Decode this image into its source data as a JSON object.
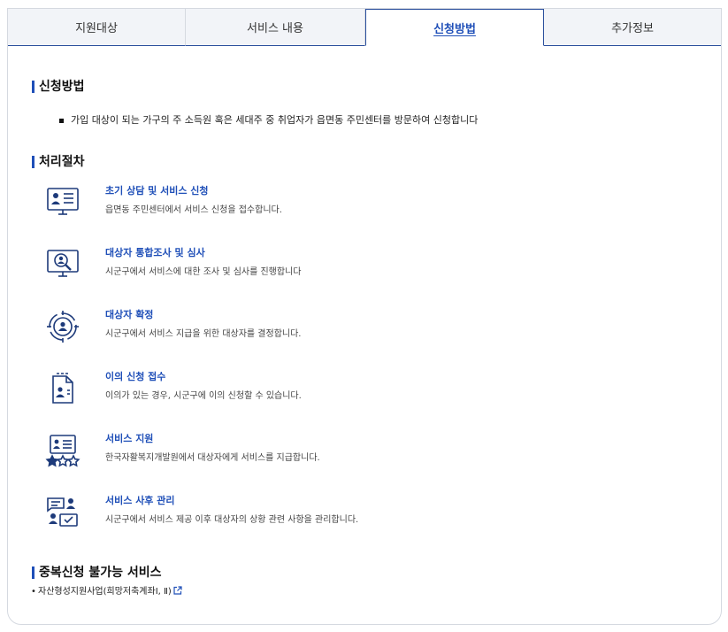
{
  "tabs": [
    {
      "label": "지원대상"
    },
    {
      "label": "서비스 내용"
    },
    {
      "label": "신청방법"
    },
    {
      "label": "추가정보"
    }
  ],
  "apply": {
    "heading": "신청방법",
    "text": "가입 대상이 되는 가구의 주 소득원 혹은 세대주 중 취업자가 읍면동 주민센터를 방문하여 신청합니다"
  },
  "process": {
    "heading": "처리절차",
    "steps": [
      {
        "title": "초기 상담 및 서비스 신청",
        "desc": "읍면동 주민센터에서 서비스 신청을 접수합니다.",
        "icon": "monitor-profile-icon"
      },
      {
        "title": "대상자 통합조사 및 심사",
        "desc": "시군구에서 서비스에 대한 조사 및 심사를 진행합니다",
        "icon": "monitor-search-user-icon"
      },
      {
        "title": "대상자 확정",
        "desc": "시군구에서 서비스 지급을 위한 대상자를 결정합니다.",
        "icon": "target-user-icon"
      },
      {
        "title": "이의 신청 접수",
        "desc": "이의가 있는 경우, 시군구에 이의 신청할 수 있습니다.",
        "icon": "document-user-icon"
      },
      {
        "title": "서비스 지원",
        "desc": "한국자활복지개발원에서 대상자에게 서비스를 지급합니다.",
        "icon": "profile-stars-icon"
      },
      {
        "title": "서비스 사후 관리",
        "desc": "시군구에서 서비스 제공 이후 대상자의 상황 관련 사항을 관리합니다.",
        "icon": "chat-user-check-icon"
      }
    ]
  },
  "duplicate": {
    "heading": "중복신청 불가능 서비스",
    "item": "자산형성지원사업(희망저축계좌Ⅰ, Ⅱ)"
  },
  "colors": {
    "accent": "#1f4fb8",
    "icon": "#1d3a7a",
    "border": "#d5d9e0",
    "tab_bg": "#f2f4f8"
  }
}
